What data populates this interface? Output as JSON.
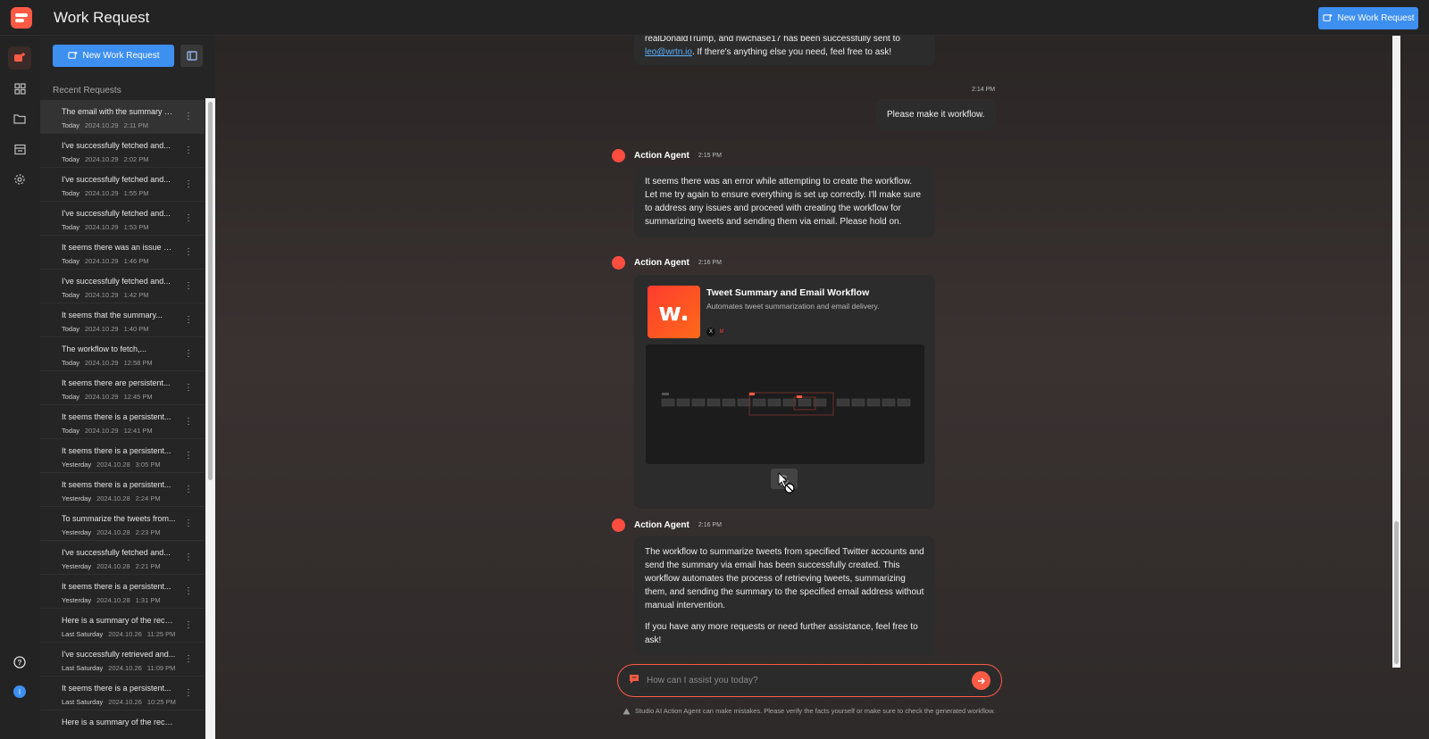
{
  "header": {
    "title": "Work Request",
    "new_request_label": "New Work Request"
  },
  "sidebar": {
    "new_request_label": "New Work Request",
    "recent_label": "Recent Requests",
    "items": [
      {
        "title": "The email with the summary of...",
        "day": "Today",
        "date": "2024.10.29",
        "time": "2:11 PM"
      },
      {
        "title": "I've successfully fetched and...",
        "day": "Today",
        "date": "2024.10.29",
        "time": "2:02 PM"
      },
      {
        "title": "I've successfully fetched and...",
        "day": "Today",
        "date": "2024.10.29",
        "time": "1:55 PM"
      },
      {
        "title": "I've successfully fetched and...",
        "day": "Today",
        "date": "2024.10.29",
        "time": "1:53 PM"
      },
      {
        "title": "It seems there was an issue wi...",
        "day": "Today",
        "date": "2024.10.29",
        "time": "1:46 PM"
      },
      {
        "title": "I've successfully fetched and...",
        "day": "Today",
        "date": "2024.10.29",
        "time": "1:42 PM"
      },
      {
        "title": "It seems that the summary...",
        "day": "Today",
        "date": "2024.10.29",
        "time": "1:40 PM"
      },
      {
        "title": "The workflow to fetch,...",
        "day": "Today",
        "date": "2024.10.29",
        "time": "12:58 PM"
      },
      {
        "title": "It seems there are persistent...",
        "day": "Today",
        "date": "2024.10.29",
        "time": "12:45 PM"
      },
      {
        "title": "It seems there is a persistent...",
        "day": "Today",
        "date": "2024.10.29",
        "time": "12:41 PM"
      },
      {
        "title": "It seems there is a persistent...",
        "day": "Yesterday",
        "date": "2024.10.28",
        "time": "3:05 PM"
      },
      {
        "title": "It seems there is a persistent...",
        "day": "Yesterday",
        "date": "2024.10.28",
        "time": "2:24 PM"
      },
      {
        "title": "To summarize the tweets from...",
        "day": "Yesterday",
        "date": "2024.10.28",
        "time": "2:23 PM"
      },
      {
        "title": "I've successfully fetched and...",
        "day": "Yesterday",
        "date": "2024.10.28",
        "time": "2:21 PM"
      },
      {
        "title": "It seems there is a persistent...",
        "day": "Yesterday",
        "date": "2024.10.28",
        "time": "1:31 PM"
      },
      {
        "title": "Here is a summary of the rece...",
        "day": "Last Saturday",
        "date": "2024.10.26",
        "time": "11:25 PM"
      },
      {
        "title": "I've successfully retrieved and...",
        "day": "Last Saturday",
        "date": "2024.10.26",
        "time": "11:09 PM"
      },
      {
        "title": "It seems there is a persistent...",
        "day": "Last Saturday",
        "date": "2024.10.26",
        "time": "10:25 PM"
      },
      {
        "title": "Here is a summary of the rece...",
        "day": "",
        "date": "",
        "time": ""
      }
    ]
  },
  "chat": {
    "prev_msg_line1": "realDonaldTrump, and nwchase17 has been successfully sent to",
    "prev_msg_link": "leo@wrtn.io",
    "prev_msg_line2_rest": ". If there's anything else you need, feel free to ask!",
    "user_time": "2:14 PM",
    "user_msg": "Please make it workflow.",
    "agent_name": "Action Agent",
    "agent1_time": "2:15 PM",
    "agent1_msg": "It seems there was an error while attempting to create the workflow. Let me try again to ensure everything is set up correctly. I'll make sure to address any issues and proceed with creating the workflow for summarizing tweets and sending them via email. Please hold on.",
    "agent2_time": "2:16 PM",
    "workflow": {
      "logo_text": "w.",
      "title": "Tweet Summary and Email Workflow",
      "description": "Automates tweet summarization and email delivery.",
      "apps": [
        "x-icon",
        "gmail-icon"
      ],
      "app_x_label": "X",
      "app_gmail_label": "M"
    },
    "agent3_time": "2:16 PM",
    "agent3_msg_p1": "The workflow to summarize tweets from specified Twitter accounts and send the summary via email has been successfully created. This workflow automates the process of retrieving tweets, summarizing them, and sending the summary to the specified email address without manual intervention.",
    "agent3_msg_p2": "If you have any more requests or need further assistance, feel free to ask!"
  },
  "input": {
    "placeholder": "How can I assist you today?"
  },
  "disclaimer": "Studio AI Action Agent can make mistakes. Please verify the facts yourself or make sure to check the generated workflow.",
  "profile_initial": "I",
  "colors": {
    "accent": "#ff5a45",
    "primary_button": "#3d8ff0",
    "link": "#5ab1ff"
  }
}
